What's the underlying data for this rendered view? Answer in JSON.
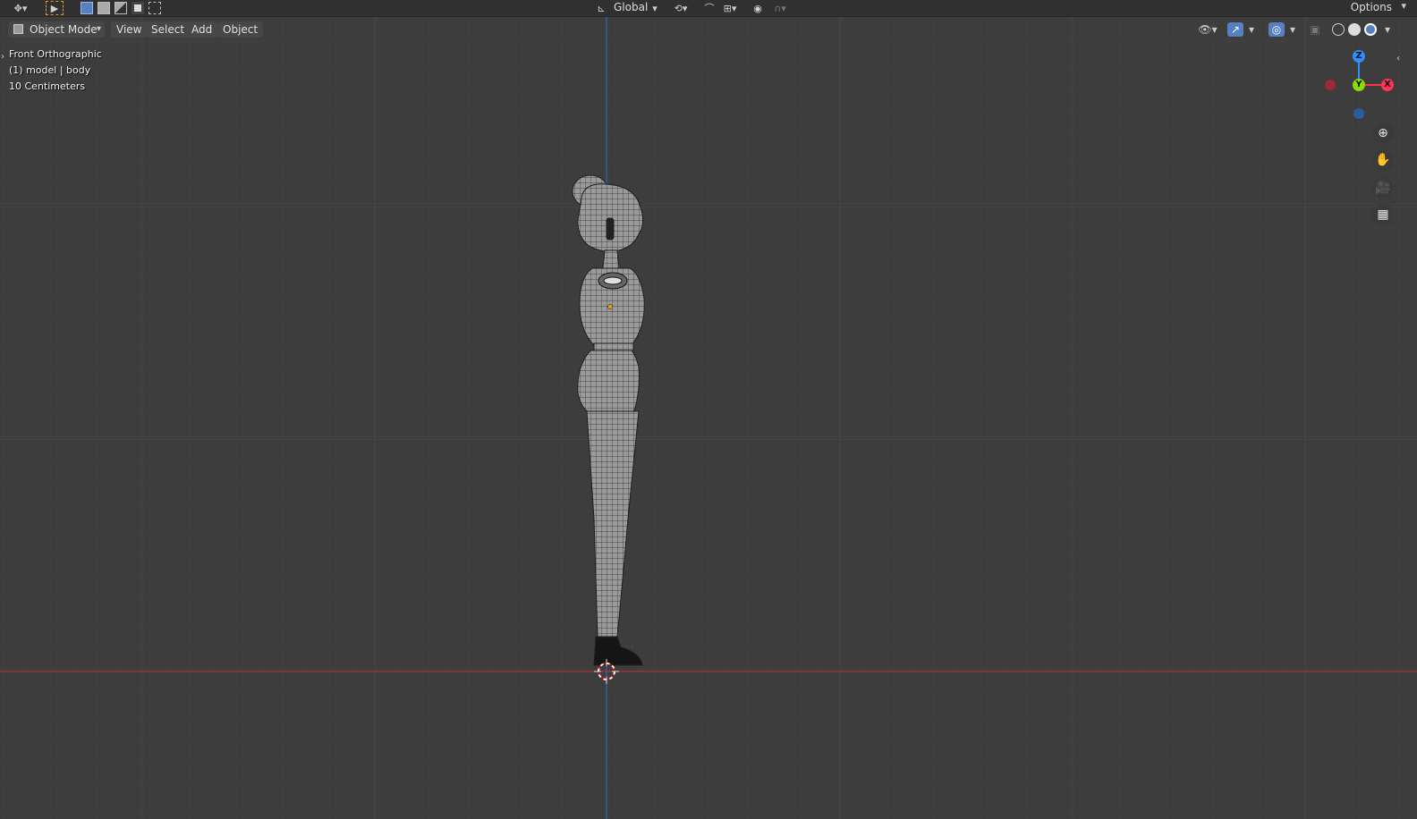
{
  "topbar": {
    "transform_orientation": "Global",
    "options_label": "Options"
  },
  "viewport_header": {
    "mode_label": "Object Mode",
    "menus": [
      "View",
      "Select",
      "Add",
      "Object"
    ]
  },
  "overlay": {
    "view_name": "Front Orthographic",
    "object_info": "(1) model | body",
    "grid_scale": "10 Centimeters"
  },
  "gizmo": {
    "z_label": "Z",
    "y_label": "Y",
    "x_label": "X"
  },
  "colors": {
    "background": "#3d3d3d",
    "x_axis": "#ff3352",
    "y_axis": "#8bdc00",
    "z_axis": "#2c8fff",
    "grid": "#464646"
  },
  "icons": {
    "nav": [
      "zoom-icon",
      "pan-hand-icon",
      "camera-icon",
      "grid-icon"
    ]
  }
}
